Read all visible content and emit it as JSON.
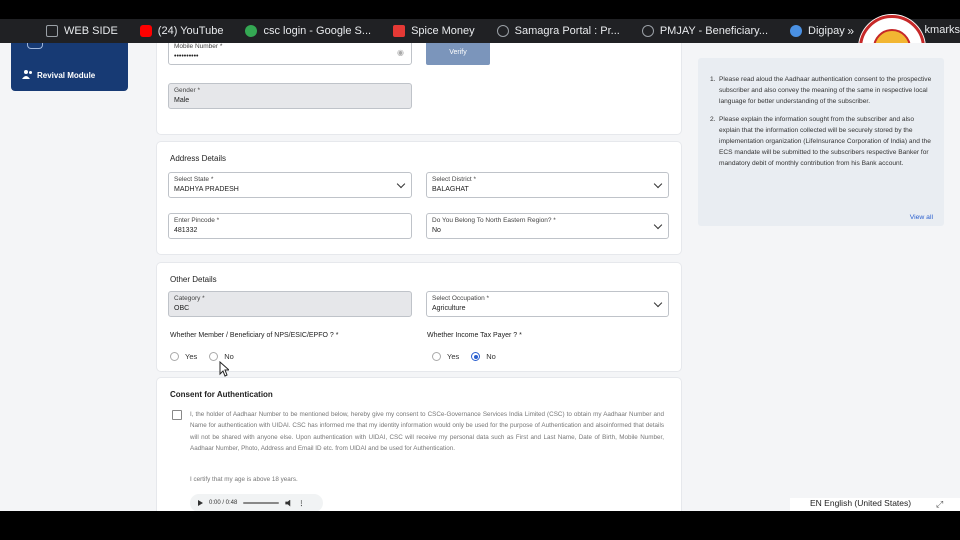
{
  "bookmarks": {
    "items": [
      {
        "label": "WEB SIDE",
        "icon": "page-icon",
        "color": "#9aa0a6"
      },
      {
        "label": "(24) YouTube",
        "icon": "youtube-icon",
        "color": "#ff0000"
      },
      {
        "label": "csc login - Google S...",
        "icon": "google-icon",
        "color": "#34a853"
      },
      {
        "label": "Spice Money",
        "icon": "spice-money-icon",
        "color": "#e53935"
      },
      {
        "label": "Samagra Portal : Pr...",
        "icon": "globe-icon",
        "color": "#9aa0a6"
      },
      {
        "label": "PMJAY - Beneficiary...",
        "icon": "globe-icon",
        "color": "#9aa0a6"
      },
      {
        "label": "Digipay",
        "icon": "digipay-icon",
        "color": "#4a90e2"
      }
    ],
    "more": "»",
    "right_label": "kmarks"
  },
  "sidebar": {
    "module_label": "Revival Module"
  },
  "personal": {
    "mobile": {
      "label": "Mobile Number *",
      "value": "••••••••••"
    },
    "verify_label": "Verify",
    "gender": {
      "label": "Gender *",
      "value": "Male"
    }
  },
  "address": {
    "title": "Address Details",
    "state": {
      "label": "Select State *",
      "value": "MADHYA PRADESH"
    },
    "district": {
      "label": "Select District *",
      "value": "BALAGHAT"
    },
    "pincode": {
      "label": "Enter Pincode *",
      "value": "481332"
    },
    "north_east": {
      "label": "Do You Belong To North Eastern Region? *",
      "value": "No"
    }
  },
  "other": {
    "title": "Other Details",
    "category": {
      "label": "Category *",
      "value": "OBC"
    },
    "occupation": {
      "label": "Select Occupation *",
      "value": "Agriculture"
    },
    "nps_question": "Whether Member / Beneficiary of NPS/ESIC/EPFO ? *",
    "nps_options": {
      "yes": "Yes",
      "no": "No",
      "selected": "none"
    },
    "tax_question": "Whether Income Tax Payer ? *",
    "tax_options": {
      "yes": "Yes",
      "no": "No",
      "selected": "No"
    }
  },
  "consent": {
    "title": "Consent for Authentication",
    "text": "I, the holder of Aadhaar Number to be mentioned below, hereby give my consent to CSCe-Governance Services India Limited (CSC) to obtain my Aadhaar Number and Name for authentication with UIDAI. CSC has informed me that my identity information would only be used for the purpose of Authentication and alsoinformed that details will not be shared with anyone else. Upon authentication with UIDAI, CSC will receive my personal data such as First and Last Name, Date of Birth, Mobile Number, Aadhaar Number, Photo, Address and Email ID etc. from UIDAI and be used for Authentication.",
    "certify": "I certify that my age is above 18 years.",
    "audio_time": "0:00 / 0:48"
  },
  "info": {
    "items": [
      {
        "num": "1.",
        "text": "Please read aloud the Aadhaar authentication consent to the prospective subscriber and also convey the meaning of the same in respective local language for better understanding of the subscriber."
      },
      {
        "num": "2.",
        "text": "Please explain the information sought from the subscriber and also explain that the information collected will be securely stored by the implementation organization (LifeInsurance Corporation of India) and the ECS mandate will be submitted to the subscribers respective Banker for mandatory debit of monthly contribution from his Bank account."
      }
    ],
    "view_all": "View all"
  },
  "language": {
    "label": "EN English (United States)"
  },
  "colors": {
    "primary": "#173a74",
    "accent": "#2a5fcf",
    "verify": "#7b95bb"
  }
}
